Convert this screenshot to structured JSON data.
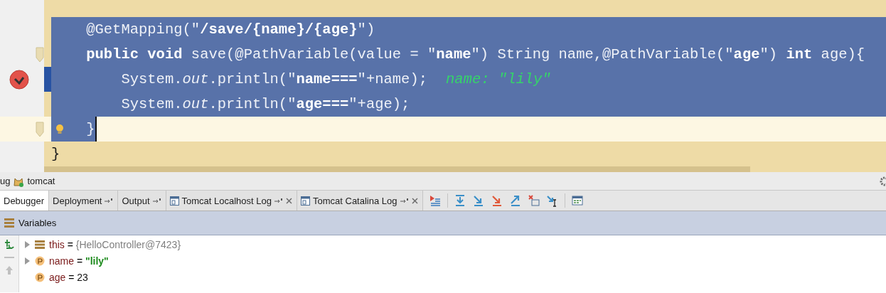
{
  "editor": {
    "lines": [
      {
        "selected": true,
        "current": false,
        "breakpoint": false,
        "fold": false,
        "bulb": false,
        "tokens": [
          {
            "text": "    @GetMapping(\"",
            "kind": "code"
          },
          {
            "text": "/save/{name}/{age}",
            "kind": "literal"
          },
          {
            "text": "\")",
            "kind": "code"
          }
        ]
      },
      {
        "selected": true,
        "current": false,
        "breakpoint": false,
        "fold": true,
        "bulb": false,
        "tokens": [
          {
            "text": "    public void",
            "kind": "keyword"
          },
          {
            "text": " save(@PathVariable(value = \"",
            "kind": "code"
          },
          {
            "text": "name",
            "kind": "literal"
          },
          {
            "text": "\") String name,@PathVariable(\"",
            "kind": "code"
          },
          {
            "text": "age",
            "kind": "literal"
          },
          {
            "text": "\") ",
            "kind": "code"
          },
          {
            "text": "int",
            "kind": "keyword"
          },
          {
            "text": " age){",
            "kind": "code"
          }
        ]
      },
      {
        "selected": true,
        "current": false,
        "breakpoint": true,
        "fold": false,
        "bulb": false,
        "tokens": [
          {
            "text": "        System.",
            "kind": "code"
          },
          {
            "text": "out",
            "kind": "static_field"
          },
          {
            "text": ".println(\"",
            "kind": "code"
          },
          {
            "text": "name===",
            "kind": "literal"
          },
          {
            "text": "\"+name);",
            "kind": "code"
          },
          {
            "text": "name: \"lily\"",
            "kind": "inline_value"
          }
        ]
      },
      {
        "selected": true,
        "current": false,
        "breakpoint": false,
        "fold": false,
        "bulb": false,
        "tokens": [
          {
            "text": "        System.",
            "kind": "code"
          },
          {
            "text": "out",
            "kind": "static_field"
          },
          {
            "text": ".println(\"",
            "kind": "code"
          },
          {
            "text": "age===",
            "kind": "literal"
          },
          {
            "text": "\"+age);",
            "kind": "code"
          }
        ]
      },
      {
        "selected": true,
        "current": true,
        "breakpoint": false,
        "fold": true,
        "bulb": true,
        "tokens": [
          {
            "text": "    }",
            "kind": "code"
          }
        ]
      },
      {
        "selected": false,
        "current": false,
        "breakpoint": false,
        "fold": false,
        "bulb": false,
        "tokens": [
          {
            "text": "}",
            "kind": "code"
          }
        ]
      }
    ]
  },
  "debug_panel": {
    "title_prefix": "ug",
    "title": "tomcat",
    "tabs": [
      {
        "label": "Debugger",
        "selected": true,
        "log_icon": false,
        "pinned": false,
        "closable": false
      },
      {
        "label": "Deployment",
        "selected": false,
        "log_icon": false,
        "pinned": true,
        "closable": false
      },
      {
        "label": "Output",
        "selected": false,
        "log_icon": false,
        "pinned": true,
        "closable": false
      },
      {
        "label": "Tomcat Localhost Log",
        "selected": false,
        "log_icon": true,
        "pinned": true,
        "closable": true
      },
      {
        "label": "Tomcat Catalina Log",
        "selected": false,
        "log_icon": true,
        "pinned": true,
        "closable": true
      }
    ],
    "variables": {
      "title": "Variables",
      "rows": [
        {
          "name": "this",
          "operator": "=",
          "value": "{HelloController@7423}",
          "kind": "object",
          "expandable": true
        },
        {
          "name": "name",
          "operator": "=",
          "value": "\"lily\"",
          "kind": "string",
          "expandable": true
        },
        {
          "name": "age",
          "operator": "=",
          "value": "23",
          "kind": "number",
          "expandable": false
        }
      ]
    }
  }
}
